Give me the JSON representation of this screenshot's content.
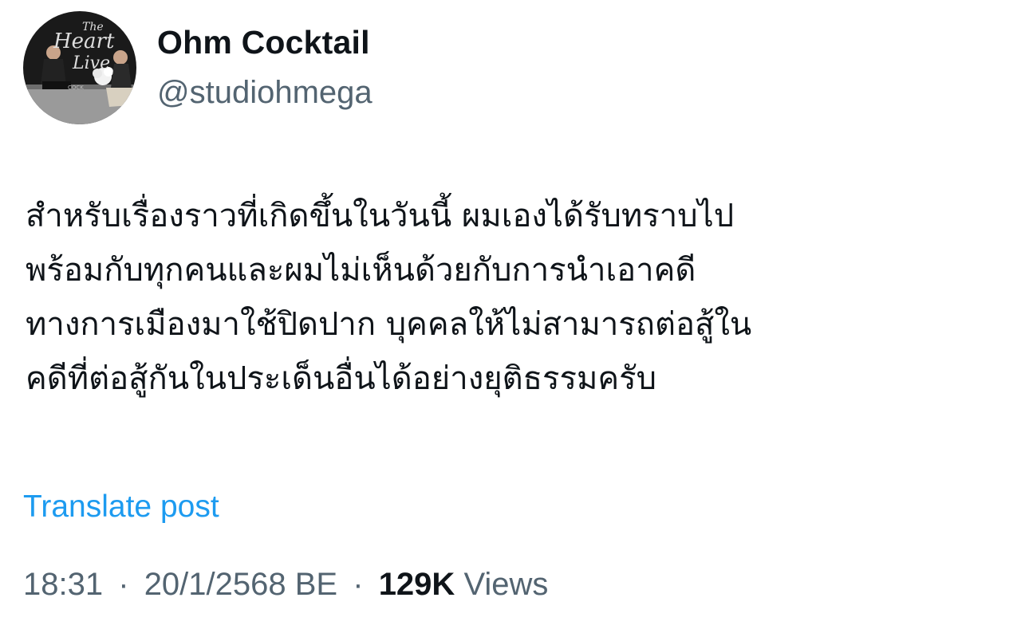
{
  "author": {
    "display_name": "Ohm Cocktail",
    "handle": "@studiohmega",
    "avatar": {
      "icon": "profile-photo-avatar",
      "overlay_text": "The Heart Live",
      "backdrop_text": "COCKTAIL"
    }
  },
  "post": {
    "lines": [
      "สำหรับเรื่องราวที่เกิดขึ้นในวันนี้ ผมเองได้รับทราบไป",
      "พร้อมกับทุกคนและผมไม่เห็นด้วยกับการนำเอาคดี",
      "ทางการเมืองมาใช้ปิดปาก บุคคลให้ไม่สามารถต่อสู้ใน",
      "คดีที่ต่อสู้กันในประเด็นอื่นได้อย่างยุติธรรมครับ"
    ],
    "translate_label": "Translate post"
  },
  "meta": {
    "time": "18:31",
    "separator": "·",
    "date": "20/1/2568 BE",
    "views_count": "129K",
    "views_label": "Views"
  },
  "colors": {
    "text": "#0f1419",
    "secondary": "#536471",
    "link": "#1d9bf0"
  }
}
